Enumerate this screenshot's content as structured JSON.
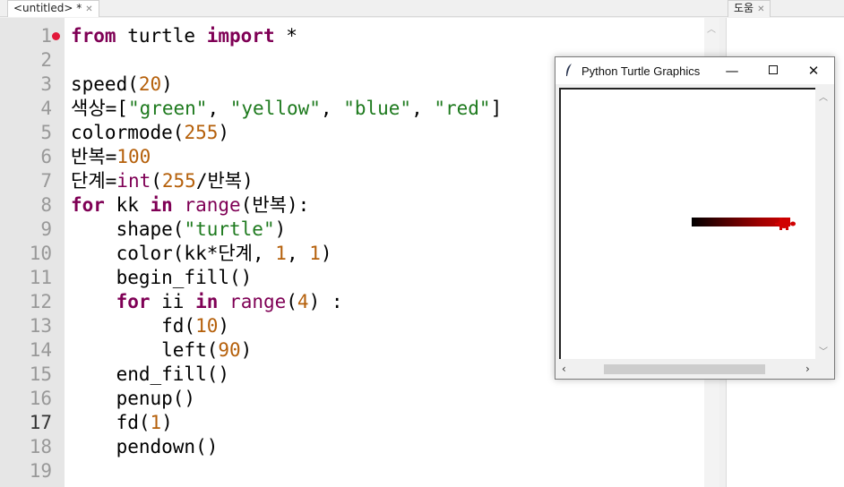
{
  "tabs": {
    "editor_tab": "<untitled> *",
    "help_tab": "도움"
  },
  "code": {
    "lines": [
      {
        "n": "1",
        "text": "from turtle import *"
      },
      {
        "n": "2",
        "text": ""
      },
      {
        "n": "3",
        "text": "speed(20)"
      },
      {
        "n": "4",
        "text": "색상=[\"green\", \"yellow\", \"blue\", \"red\"]"
      },
      {
        "n": "5",
        "text": "colormode(255)"
      },
      {
        "n": "6",
        "text": "반복=100"
      },
      {
        "n": "7",
        "text": "단계=int(255/반복)"
      },
      {
        "n": "8",
        "text": "for kk in range(반복):"
      },
      {
        "n": "9",
        "text": "    shape(\"turtle\")"
      },
      {
        "n": "10",
        "text": "    color(kk*단계, 1, 1)"
      },
      {
        "n": "11",
        "text": "    begin_fill()"
      },
      {
        "n": "12",
        "text": "    for ii in range(4) :"
      },
      {
        "n": "13",
        "text": "        fd(10)"
      },
      {
        "n": "14",
        "text": "        left(90)"
      },
      {
        "n": "15",
        "text": "    end_fill()"
      },
      {
        "n": "16",
        "text": "    penup()"
      },
      {
        "n": "17",
        "text": "    fd(1)"
      },
      {
        "n": "18",
        "text": "    pendown()"
      },
      {
        "n": "19",
        "text": ""
      }
    ],
    "active_line": "17",
    "breakpoint_line": "1"
  },
  "turtle_window": {
    "title": "Python Turtle Graphics",
    "min_glyph": "—",
    "close_glyph": "✕",
    "icon": "feather-icon"
  },
  "colors": {
    "keyword": "#7f0055",
    "number": "#b5600b",
    "string": "#1e7a1e",
    "breakpoint": "#e2183a",
    "turtle_fill": "#d00000"
  }
}
